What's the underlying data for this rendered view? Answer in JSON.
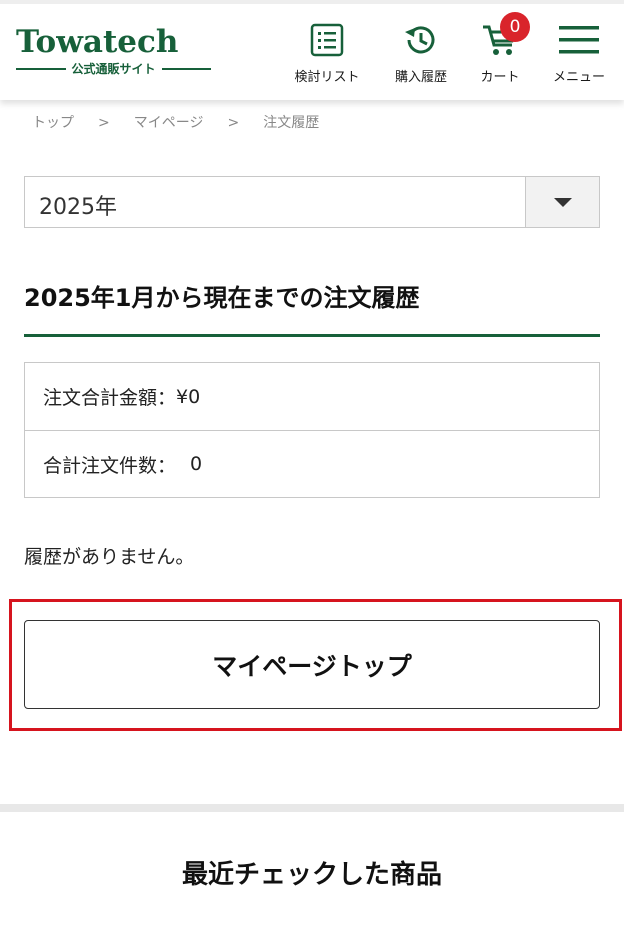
{
  "header": {
    "logo_main": "Towatech",
    "logo_sub": "公式通販サイト",
    "nav": {
      "wishlist_label": "検討リスト",
      "history_label": "購入履歴",
      "cart_label": "カート",
      "cart_count": "0",
      "menu_label": "メニュー"
    }
  },
  "breadcrumb": {
    "items": [
      "トップ",
      "マイページ",
      "注文履歴"
    ],
    "separator": ">"
  },
  "year_select": {
    "value": "2025年"
  },
  "section": {
    "title": "2025年1月から現在までの注文履歴"
  },
  "summary": {
    "total_amount_label": "注文合計金額：",
    "total_amount_value": "¥0",
    "order_count_label": "合計注文件数：",
    "order_count_value": "0"
  },
  "empty_message": "履歴がありません。",
  "mypage_button_label": "マイページトップ",
  "recent": {
    "title": "最近チェックした商品"
  },
  "colors": {
    "brand_green": "#17603a",
    "highlight_red": "#d6141e",
    "badge_red": "#d9242b"
  }
}
